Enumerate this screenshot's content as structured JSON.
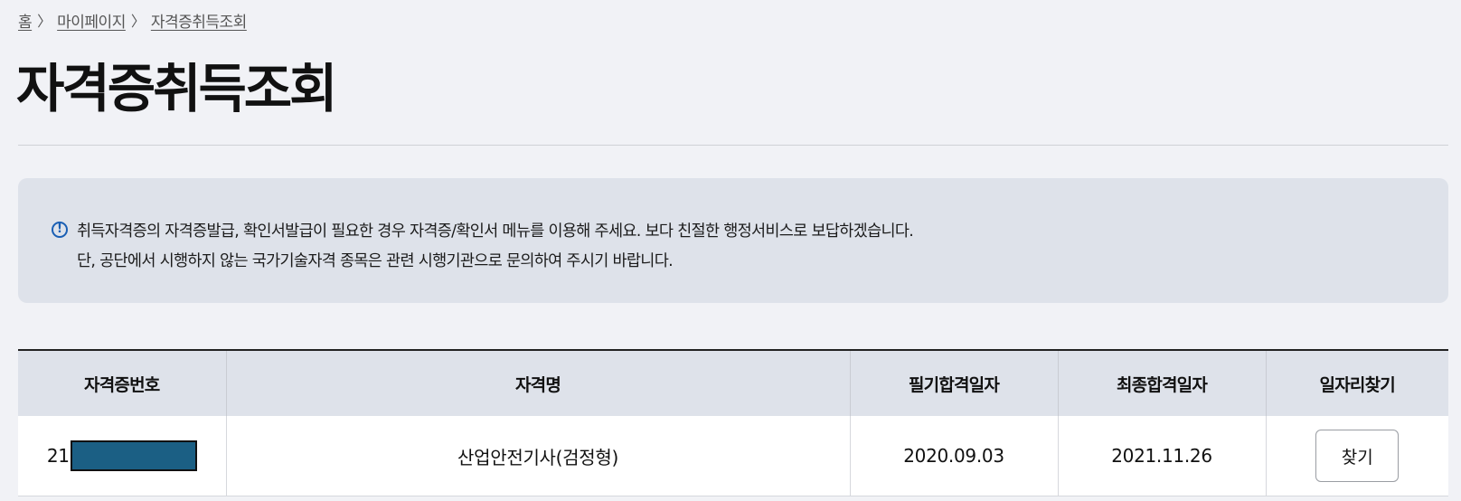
{
  "breadcrumb": {
    "home": "홈",
    "separator": "〉",
    "mypage": "마이페이지",
    "current": "자격증취득조회"
  },
  "page": {
    "title": "자격증취득조회"
  },
  "notice": {
    "icon": "info-circle-icon",
    "icon_glyph": "!",
    "line1": "취득자격증의 자격증발급, 확인서발급이 필요한 경우 자격증/확인서 메뉴를 이용해 주세요. 보다 친절한 행정서비스로 보답하겠습니다.",
    "line2": "단, 공단에서 시행하지 않는 국가기술자격 종목은 관련 시행기관으로 문의하여 주시기 바랍니다."
  },
  "table": {
    "headers": [
      "자격증번호",
      "자격명",
      "필기합격일자",
      "최종합격일자",
      "일자리찾기"
    ],
    "rows": [
      {
        "cert_number_prefix": "21",
        "cert_name": "산업안전기사(검정형)",
        "written_pass_date": "2020.09.03",
        "final_pass_date": "2021.11.26",
        "find_button": "찾기"
      }
    ]
  },
  "colors": {
    "background": "#f1f2f6",
    "notice_bg": "#dee2ea",
    "header_bg": "#dee2ea",
    "info_icon": "#1a5fb4",
    "redaction": "#1b5f84"
  }
}
